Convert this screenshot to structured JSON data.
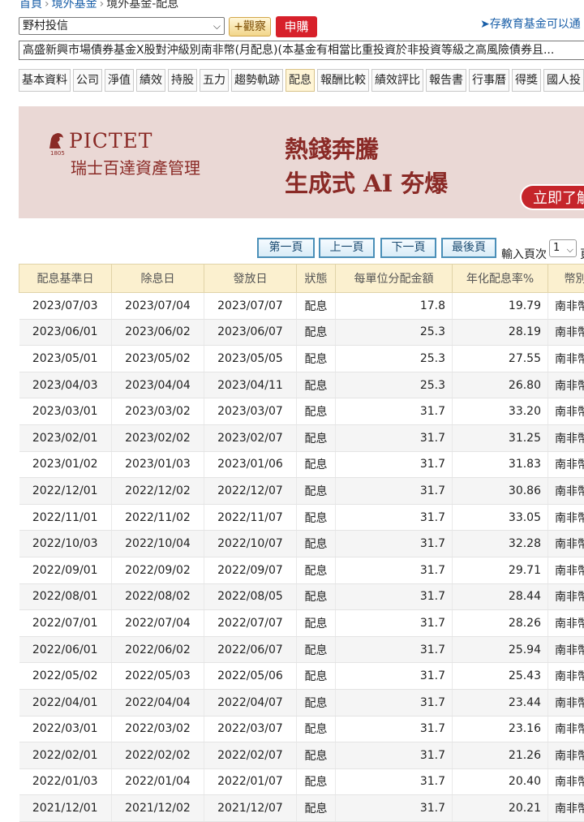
{
  "breadcrumb": [
    "首頁",
    "境外基金",
    "境外基金-配息"
  ],
  "company_select": {
    "value": "野村投信"
  },
  "watch_button": "+觀察",
  "buy_button": "申購",
  "edu_link": "➤存教育基金可以通",
  "fund_name": "高盛新興市場債券基金X股對沖級別南非幣(月配息)(本基金有相當比重投資於非投資等級之高風險債券且...",
  "tabs": [
    {
      "label": "基本資料"
    },
    {
      "label": "公司"
    },
    {
      "label": "淨值"
    },
    {
      "label": "績效"
    },
    {
      "label": "持股"
    },
    {
      "label": "五力"
    },
    {
      "label": "趨勢軌跡"
    },
    {
      "label": "配息",
      "active": true
    },
    {
      "label": "報酬比較"
    },
    {
      "label": "績效評比"
    },
    {
      "label": "報告書"
    },
    {
      "label": "行事曆"
    },
    {
      "label": "得獎"
    },
    {
      "label": "國人投"
    }
  ],
  "banner": {
    "brand": "PICTET",
    "year": "1805",
    "brand_cn": "瑞士百達資產管理",
    "headline1": "熱錢奔騰",
    "headline2": "生成式 AI 夯爆",
    "cta": "立即了解"
  },
  "pagination": {
    "first": "第一頁",
    "prev": "上一頁",
    "next": "下一頁",
    "last": "最後頁",
    "input_label": "輸入頁次",
    "page_value": "1",
    "suffix": "頁"
  },
  "table": {
    "headers": [
      "配息基準日",
      "除息日",
      "發放日",
      "狀態",
      "每單位分配金額",
      "年化配息率%",
      "幣別"
    ],
    "rows": [
      [
        "2023/07/03",
        "2023/07/04",
        "2023/07/07",
        "配息",
        "17.8",
        "19.79",
        "南非幣"
      ],
      [
        "2023/06/01",
        "2023/06/02",
        "2023/06/07",
        "配息",
        "25.3",
        "28.19",
        "南非幣"
      ],
      [
        "2023/05/01",
        "2023/05/02",
        "2023/05/05",
        "配息",
        "25.3",
        "27.55",
        "南非幣"
      ],
      [
        "2023/04/03",
        "2023/04/04",
        "2023/04/11",
        "配息",
        "25.3",
        "26.80",
        "南非幣"
      ],
      [
        "2023/03/01",
        "2023/03/02",
        "2023/03/07",
        "配息",
        "31.7",
        "33.20",
        "南非幣"
      ],
      [
        "2023/02/01",
        "2023/02/02",
        "2023/02/07",
        "配息",
        "31.7",
        "31.25",
        "南非幣"
      ],
      [
        "2023/01/02",
        "2023/01/03",
        "2023/01/06",
        "配息",
        "31.7",
        "31.83",
        "南非幣"
      ],
      [
        "2022/12/01",
        "2022/12/02",
        "2022/12/07",
        "配息",
        "31.7",
        "30.86",
        "南非幣"
      ],
      [
        "2022/11/01",
        "2022/11/02",
        "2022/11/07",
        "配息",
        "31.7",
        "33.05",
        "南非幣"
      ],
      [
        "2022/10/03",
        "2022/10/04",
        "2022/10/07",
        "配息",
        "31.7",
        "32.28",
        "南非幣"
      ],
      [
        "2022/09/01",
        "2022/09/02",
        "2022/09/07",
        "配息",
        "31.7",
        "29.71",
        "南非幣"
      ],
      [
        "2022/08/01",
        "2022/08/02",
        "2022/08/05",
        "配息",
        "31.7",
        "28.44",
        "南非幣"
      ],
      [
        "2022/07/01",
        "2022/07/04",
        "2022/07/07",
        "配息",
        "31.7",
        "28.26",
        "南非幣"
      ],
      [
        "2022/06/01",
        "2022/06/02",
        "2022/06/07",
        "配息",
        "31.7",
        "25.94",
        "南非幣"
      ],
      [
        "2022/05/02",
        "2022/05/03",
        "2022/05/06",
        "配息",
        "31.7",
        "25.43",
        "南非幣"
      ],
      [
        "2022/04/01",
        "2022/04/04",
        "2022/04/07",
        "配息",
        "31.7",
        "23.44",
        "南非幣"
      ],
      [
        "2022/03/01",
        "2022/03/02",
        "2022/03/07",
        "配息",
        "31.7",
        "23.16",
        "南非幣"
      ],
      [
        "2022/02/01",
        "2022/02/02",
        "2022/02/07",
        "配息",
        "31.7",
        "21.26",
        "南非幣"
      ],
      [
        "2022/01/03",
        "2022/01/04",
        "2022/01/07",
        "配息",
        "31.7",
        "20.40",
        "南非幣"
      ],
      [
        "2021/12/01",
        "2021/12/02",
        "2021/12/07",
        "配息",
        "31.7",
        "20.21",
        "南非幣"
      ]
    ]
  },
  "colors": {
    "link": "#1a5fa8",
    "buy": "#d7202a",
    "banner_bg": "#ead8d5",
    "banner_text": "#8a2a26",
    "header_bg": "#fbf0cf",
    "alt_row": "#f5f5f5",
    "pager_border": "#4a8fb8"
  }
}
